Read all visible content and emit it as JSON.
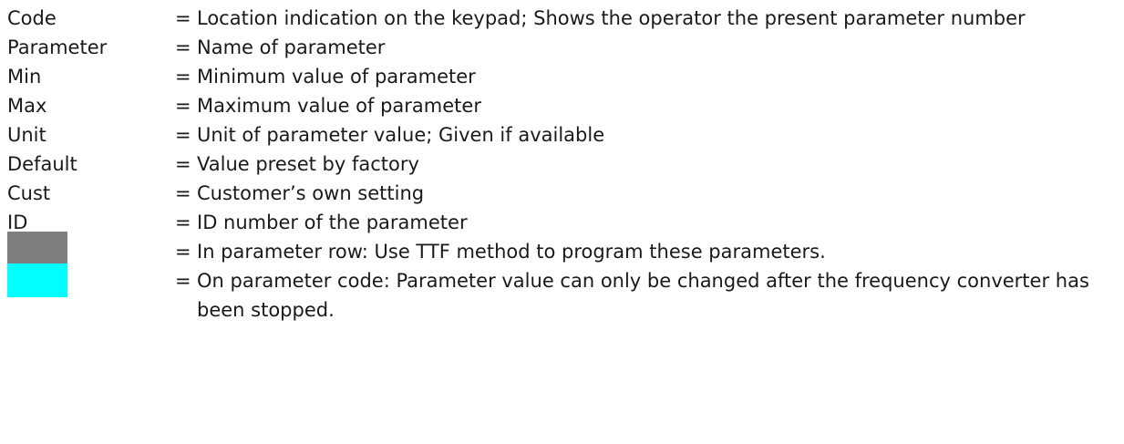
{
  "legend": {
    "rows": [
      {
        "term": "Code",
        "desc": "Location indication on the keypad; Shows the operator the present parameter number"
      },
      {
        "term": "Parameter",
        "desc": "Name of parameter"
      },
      {
        "term": "Min",
        "desc": "Minimum value of parameter"
      },
      {
        "term": "Max",
        "desc": "Maximum value of parameter"
      },
      {
        "term": "Unit",
        "desc": "Unit of parameter value; Given if available"
      },
      {
        "term": "Default",
        "desc": "Value preset by factory"
      },
      {
        "term": "Cust",
        "desc": "Customer’s own setting"
      },
      {
        "term": "ID",
        "desc": "ID number of the parameter"
      }
    ],
    "swatch_rows": [
      {
        "desc": "In parameter row: Use TTF method to program these parameters.",
        "color": "#7f7f7f"
      },
      {
        "desc": "On parameter code: Parameter value can only be changed after the frequency converter has been stopped.",
        "color": "#00ffff"
      }
    ],
    "eq_sign": "="
  }
}
